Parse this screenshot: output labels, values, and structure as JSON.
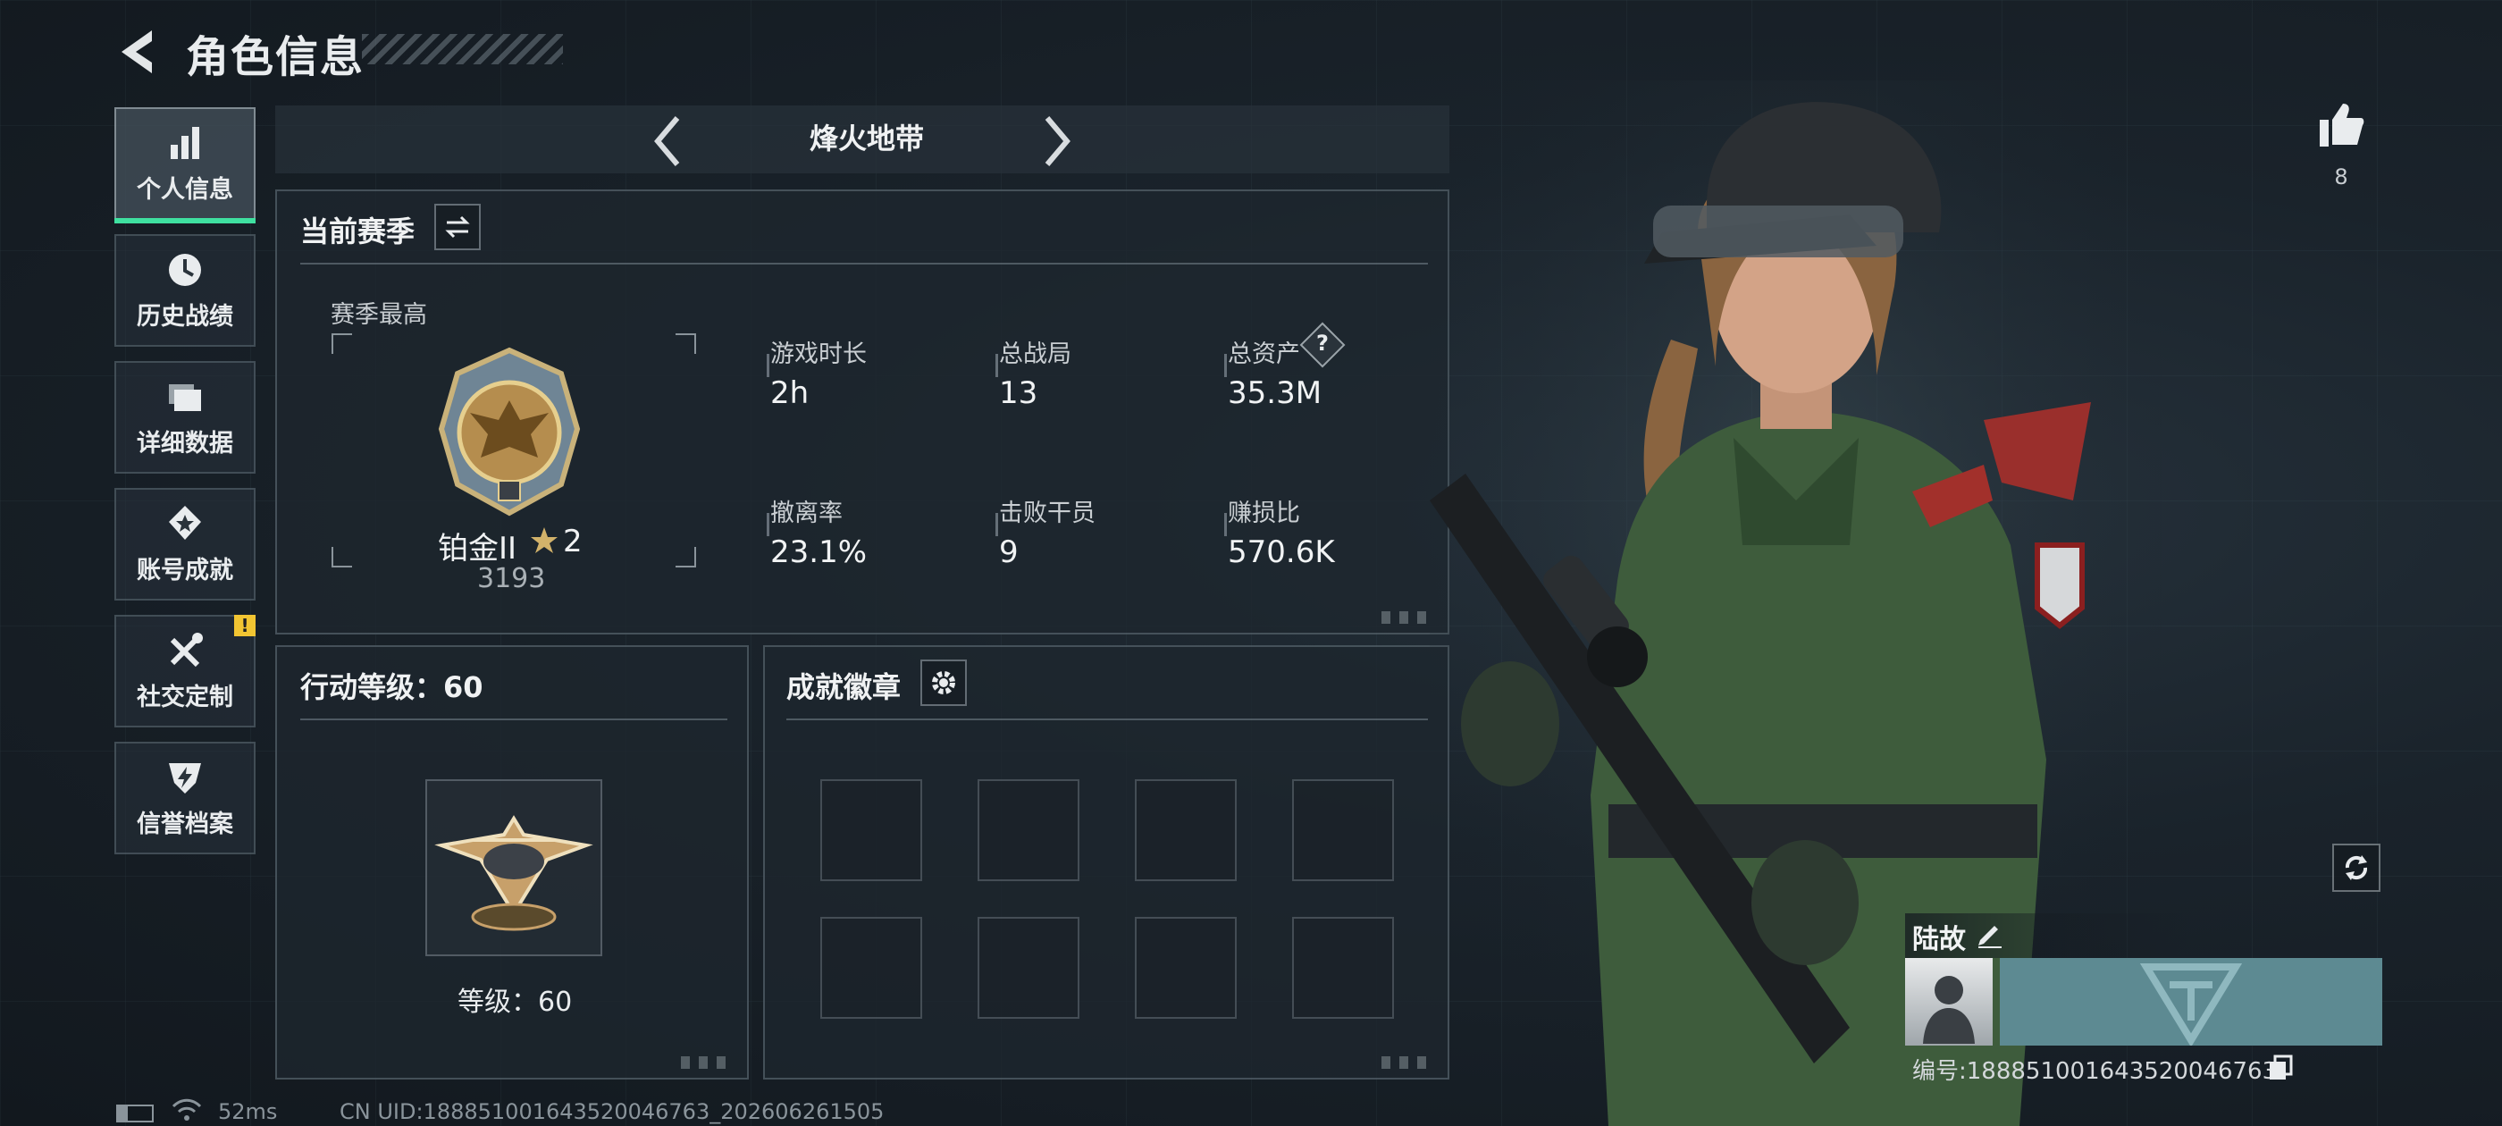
{
  "header": {
    "title": "角色信息"
  },
  "sidebar": {
    "items": [
      {
        "label": "个人信息",
        "icon": "bar-chart-icon",
        "active": true
      },
      {
        "label": "历史战绩",
        "icon": "clock-icon"
      },
      {
        "label": "详细数据",
        "icon": "folder-icon"
      },
      {
        "label": "账号成就",
        "icon": "medal-icon"
      },
      {
        "label": "社交定制",
        "icon": "tools-icon",
        "badge": "!"
      },
      {
        "label": "信誉档案",
        "icon": "shield-lightning-icon"
      }
    ]
  },
  "mode_selector": {
    "label": "烽火地带"
  },
  "season": {
    "title": "当前赛季",
    "best_label": "赛季最高",
    "rank_name": "铂金II",
    "rank_stars": "2",
    "rank_points": "3193",
    "stats": [
      {
        "label": "游戏时长",
        "value": "2h"
      },
      {
        "label": "总战局",
        "value": "13"
      },
      {
        "label": "总资产",
        "value": "35.3M",
        "help": "?"
      },
      {
        "label": "撤离率",
        "value": "23.1%"
      },
      {
        "label": "击败干员",
        "value": "9"
      },
      {
        "label": "赚损比",
        "value": "570.6K"
      }
    ]
  },
  "action_level": {
    "title": "行动等级：60",
    "level_text": "等级：60"
  },
  "achievements": {
    "title": "成就徽章",
    "slot_count": 8
  },
  "profile": {
    "likes": "8",
    "name": "陆故",
    "id_text": "编号:18885100164352004676​3"
  },
  "status_bar": {
    "ping": "52ms",
    "uid": "CN UID:18885100164352004676​3_202606261505"
  },
  "colors": {
    "accent": "#3fe0a0",
    "badge": "#f2c532"
  }
}
